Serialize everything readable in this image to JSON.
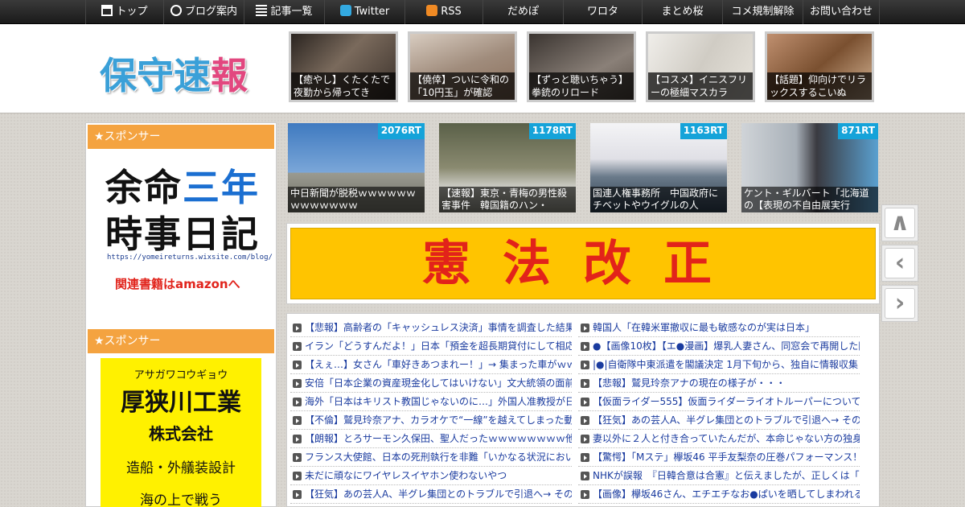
{
  "nav": {
    "items": [
      {
        "label": "トップ",
        "icon": "home-icon"
      },
      {
        "label": "ブログ案内",
        "icon": "info-icon"
      },
      {
        "label": "記事一覧",
        "icon": "list-icon"
      },
      {
        "label": "Twitter",
        "icon": "twitter-icon"
      },
      {
        "label": "RSS",
        "icon": "rss-icon"
      },
      {
        "label": "だめぽ"
      },
      {
        "label": "ワロタ"
      },
      {
        "label": "まとめ桜"
      },
      {
        "label": "コメ規制解除"
      },
      {
        "label": "お問い合わせ"
      }
    ]
  },
  "header": {
    "logo": {
      "c1": "保",
      "c2": "守",
      "c3": "速",
      "c4": "報"
    },
    "thumbs": [
      {
        "caption": "【癒やし】くたくたで夜勤から帰ってき",
        "color": "#5a5048"
      },
      {
        "caption": "【僥倖】ついに令和の「10円玉」が確認",
        "color": "#a89888"
      },
      {
        "caption": "【ずっと聴いちゃう】拳銃のリロード",
        "color": "#6a6058"
      },
      {
        "caption": "【コスメ】イニスフリーの極細マスカラ",
        "color": "#c8c4bc"
      },
      {
        "caption": "【話題】仰向けでリラックスするこいぬ",
        "color": "#9a7050"
      }
    ]
  },
  "sidebar": {
    "sponsor1": "★スポンサー",
    "ad1": {
      "line1a": "余命",
      "line1b": "三年",
      "line2": "時事日記",
      "url": "https://yomeireturns.wixsite.com/blog/",
      "amazon": "関連書籍はamazonへ"
    },
    "sponsor2": "★スポンサー",
    "ad2": {
      "kana": "アサガワコウギョウ",
      "name": "厚狭川工業",
      "corp": "株式会社",
      "business": "造船・外艤装設計",
      "slogan": "海の上で戦う"
    }
  },
  "rt_cards": [
    {
      "badge": "2076RT",
      "caption": "中日新聞が脱税ｗｗｗｗｗｗｗｗｗｗｗｗｗ",
      "color": "#5a86b8"
    },
    {
      "badge": "1178RT",
      "caption": "【速報】東京・青梅の男性殺害事件　韓国籍のハン・",
      "color": "#6b7058"
    },
    {
      "badge": "1163RT",
      "caption": "国連人権事務所　中国政府にチベットやウイグルの人",
      "color": "#e8e8ec"
    },
    {
      "badge": "871RT",
      "caption": "ケント・ギルバート「北海道の【表現の不自由展実行",
      "color": "#8a9098"
    }
  ],
  "banner": {
    "text": "憲法改正"
  },
  "side_buttons": {
    "up": "∧",
    "prev": "‹",
    "next": "›"
  },
  "list_left": [
    "【悲報】高齢者の「キャッシュレス決済」事情を調査した結果",
    "イラン「どうすんだよ！」日本「預金を超長期貸付にして相応",
    "【えぇ…】女さん「車好きあつまれー！」→ 集まった車がｗｗ",
    "安倍「日本企業の資産現金化してはいけない」文大統領の面前",
    "海外「日本はキリスト教国じゃないのに…」外国人准教授が日",
    "【不倫】鷲見玲奈アナ、カラオケで“一線”を越えてしまった動",
    "【朗報】とろサーモン久保田、聖人だったｗｗｗｗｗｗｗｗ他",
    "フランス大使館、日本の死刑執行を非難「いかなる状況におい",
    "未だに頑なにワイヤレスイヤホン使わないやつ",
    "【狂気】あの芸人A、半グレ集団とのトラブルで引退へ→ その"
  ],
  "list_right": [
    "韓国人「在韓米軍撤収に最も敏感なのが実は日本」",
    "●【画像10枚】【エ●漫画】爆乳人妻さん、同窓会で再開した同",
    "|●|自衛隊中東派遣を閣議決定 1月下旬から、独自に情報収集 ホ",
    "【悲報】鷲見玲奈アナの現在の様子が・・・",
    "【仮面ライダー555】仮面ライダーライオトルーパーについてか",
    "【狂気】あの芸人A、半グレ集団とのトラブルで引退へ→ その",
    "妻以外に２人と付き合っていたんだが、本命じゃない方の独身",
    "【驚愕】「Mステ」欅坂46 平手友梨奈の圧巻パフォーマンス！",
    "NHKが誤報　『日韓合意は合憲』と伝えましたが、正しくは「",
    "【画像】欅坂46さん、エチエチなお●ぱいを晒してしまわれるｗ"
  ]
}
